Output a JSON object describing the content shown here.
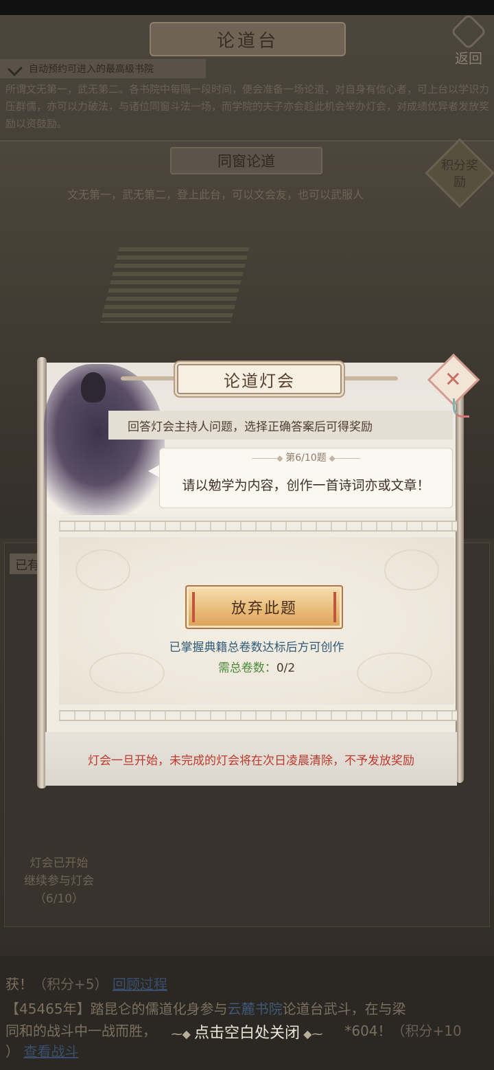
{
  "header": {
    "title": "论道台",
    "back_label": "返回"
  },
  "auto_reserve": {
    "label": "自动预约可进入的最高级书院",
    "checked": true
  },
  "intro": {
    "text": "所谓文无第一，武无第二。各书院中每隔一段时间，便会准备一场论道，对自身有信心者，可上台以学识力压群儒，亦可以力破法，与诸位同窗斗法一场，而学院的夫子亦会趁此机会举办灯会，对成绩优异者发放奖励以资鼓励。"
  },
  "scene": {
    "title": "同窗论道",
    "subtitle": "文无第一，武无第二，登上此台，可以文会友，也可以武服人",
    "reward_badge": "积分奖励"
  },
  "lower_panel": {
    "tag": "已有",
    "lantern_status": [
      "灯会已开始",
      "继续参与灯会",
      "（6/10）"
    ]
  },
  "modal": {
    "title": "论道灯会",
    "instruction": "回答灯会主持人问题，选择正确答案后可得奖励",
    "question_index": "第6/10题",
    "question_text": "请以勉学为内容，创作一首诗词亦或文章！",
    "abandon_button": "放弃此题",
    "requirement_text": "已掌握典籍总卷数达标后方可创作",
    "requirement_label": "需总卷数：",
    "requirement_value": "0/2",
    "footer_warning": "灯会一旦开始，未完成的灯会将在次日凌晨清除，不予发放奖励",
    "close_icon": "close-icon"
  },
  "log": {
    "line1": "获！",
    "line1_score": "（积分+5）",
    "line1_link": "回顾过程",
    "line2_prefix": "【45465年】踏昆仑的儒道化身参与",
    "line2_place": "云麓书院",
    "line2_suffix": "论道台武斗，在与梁",
    "line3_prefix": "同和的战斗中一战而胜，",
    "line3_reward": "*604！",
    "line3_score": "（积分+10",
    "line4_prefix": "）",
    "line4_link": "查看战斗"
  },
  "close_hint": "点击空白处关闭",
  "colors": {
    "accent_red": "#c0392b",
    "link_blue": "#2f5a7a",
    "count_green": "#4a8a3a",
    "button_gold": "#e9bd7a"
  }
}
